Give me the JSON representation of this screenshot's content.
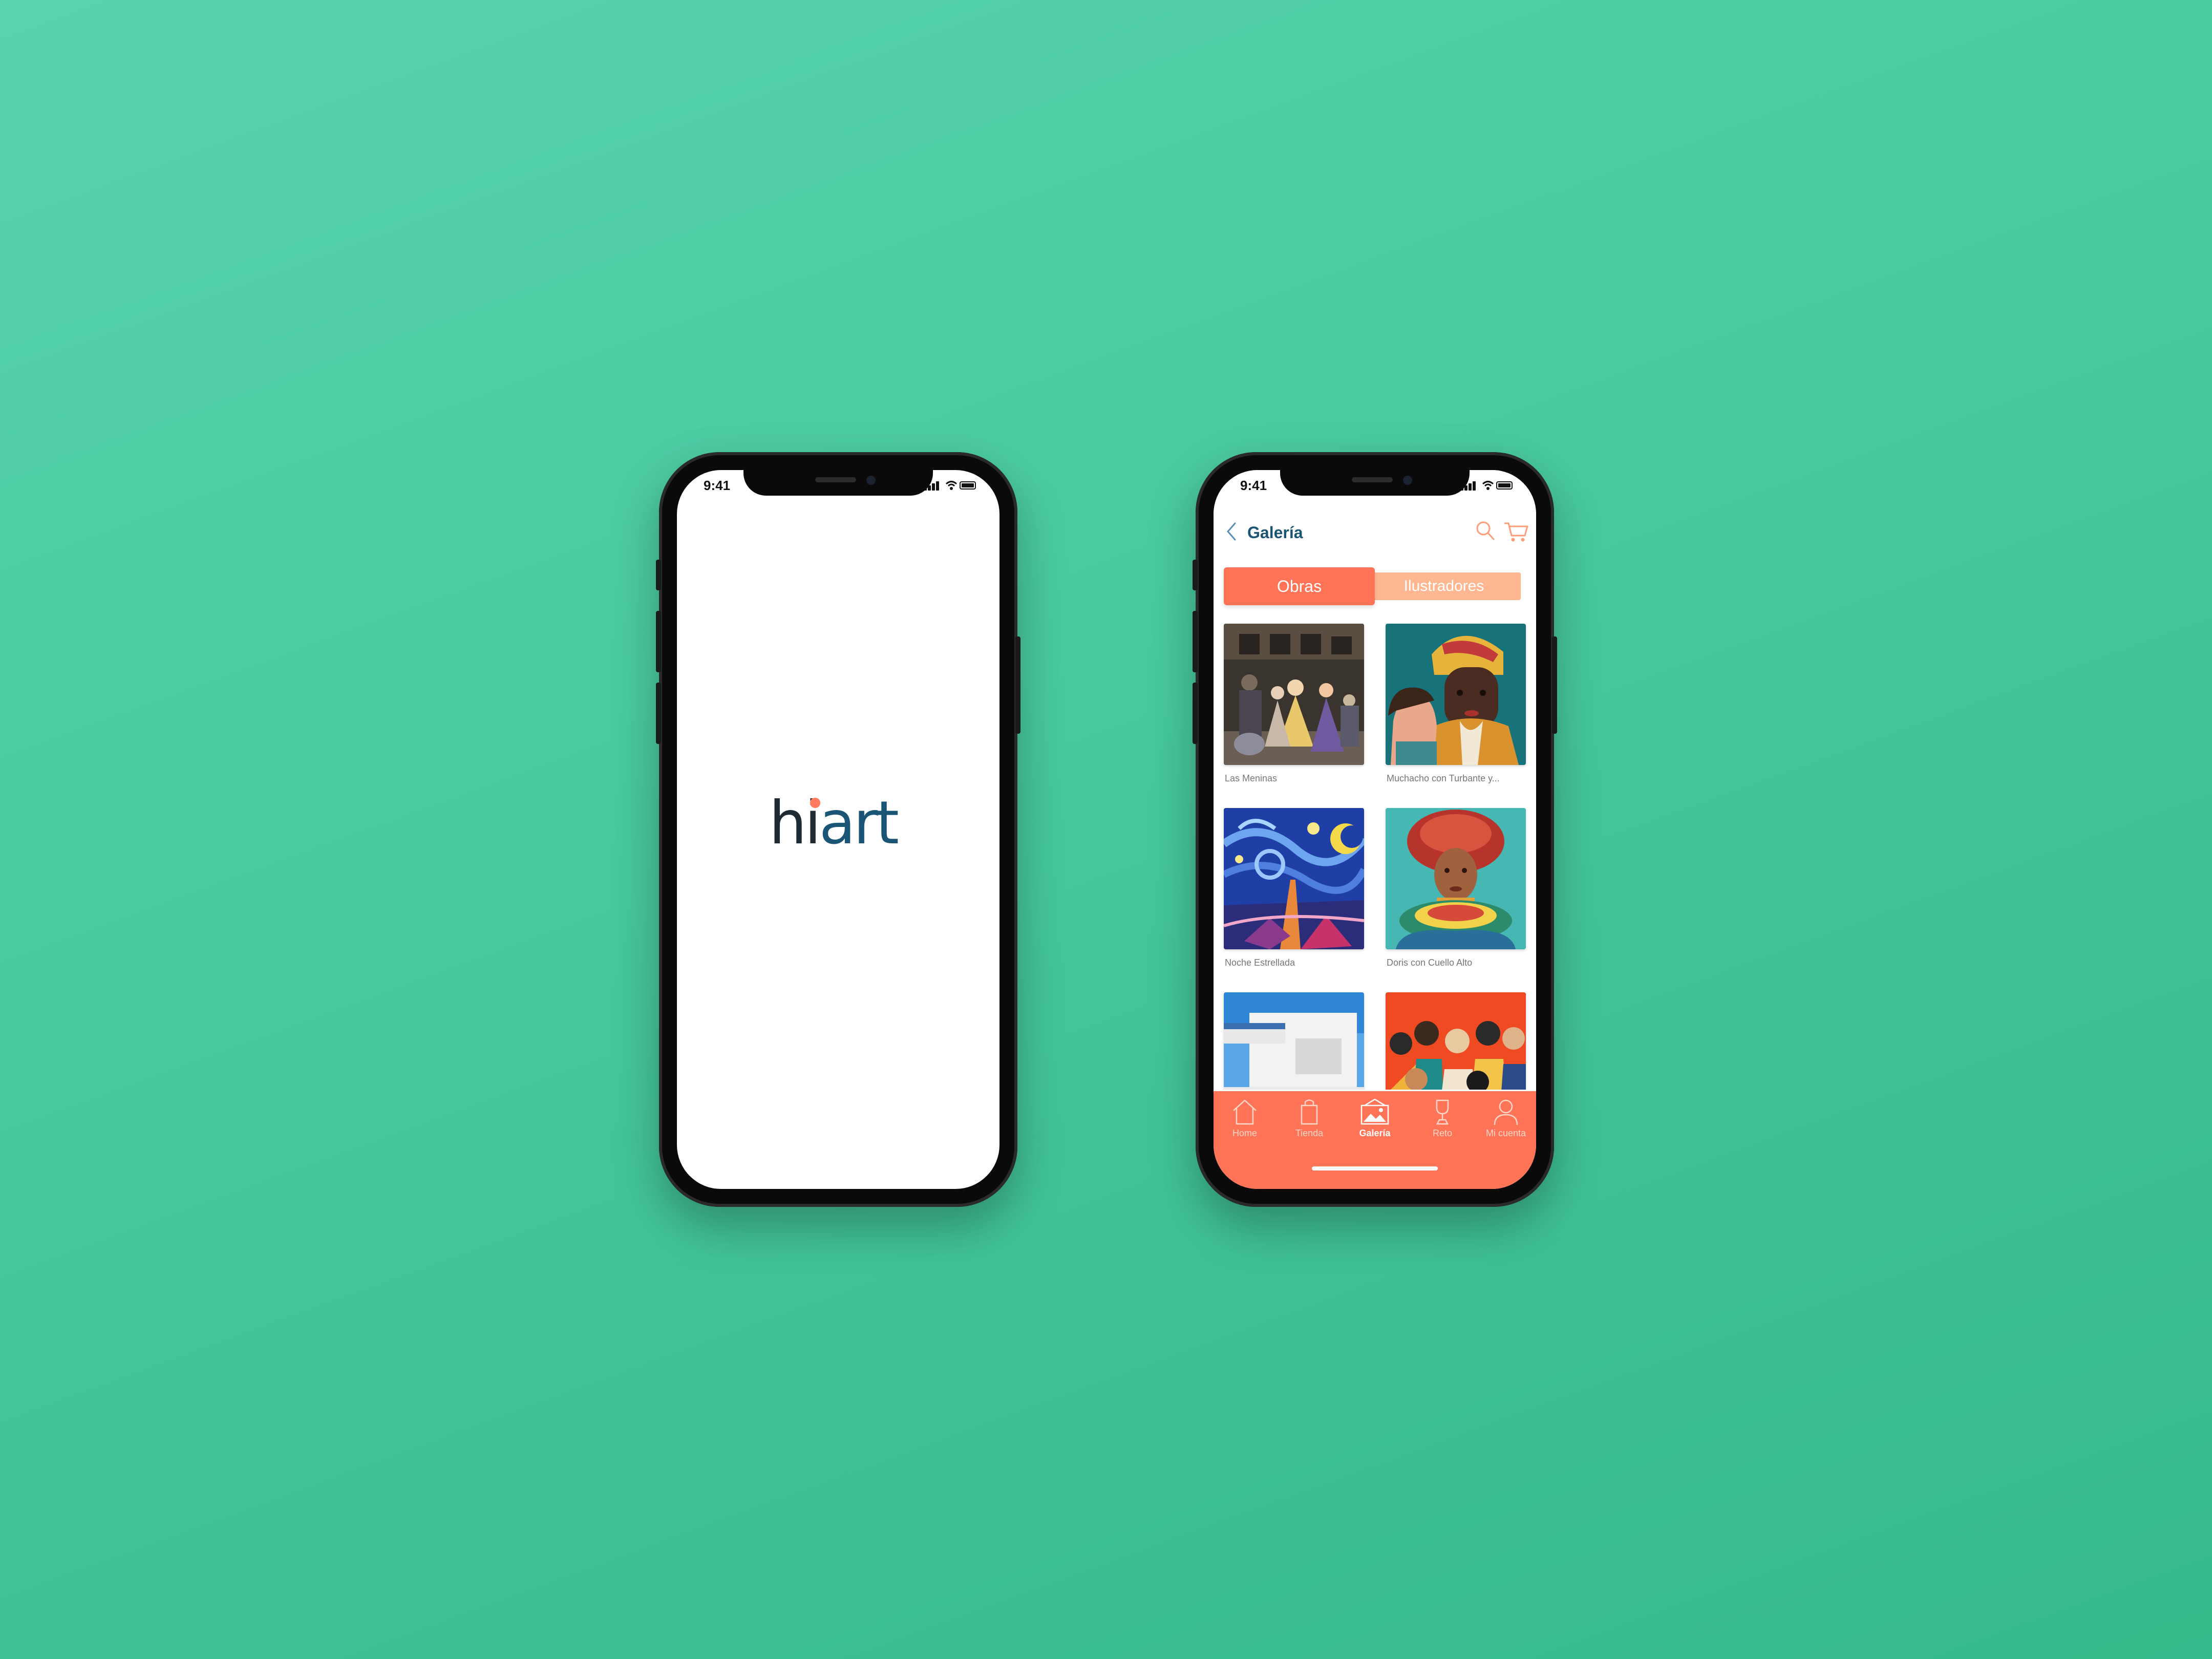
{
  "status_bar": {
    "time": "9:41"
  },
  "splash": {
    "logo_hi": "hi",
    "logo_art": "art"
  },
  "gallery": {
    "header": {
      "title": "Galería"
    },
    "segments": {
      "active": "Obras",
      "inactive": "Ilustradores"
    },
    "artworks": [
      {
        "title": "Las Meninas"
      },
      {
        "title": "Muchacho con Turbante y..."
      },
      {
        "title": "Noche Estrellada"
      },
      {
        "title": "Doris con Cuello Alto"
      },
      {
        "title": ""
      },
      {
        "title": ""
      }
    ],
    "tabbar": [
      {
        "label": "Home",
        "icon": "home-icon",
        "active": false
      },
      {
        "label": "Tienda",
        "icon": "shopping-bag-icon",
        "active": false
      },
      {
        "label": "Galería",
        "icon": "gallery-icon",
        "active": true
      },
      {
        "label": "Reto",
        "icon": "trophy-icon",
        "active": false
      },
      {
        "label": "Mi cuenta",
        "icon": "user-icon",
        "active": false
      }
    ]
  },
  "colors": {
    "background": "#4ccba2",
    "accent_coral": "#ff7457",
    "accent_peach": "#ffb792",
    "brand_blue": "#1b5576",
    "logo_dot": "#ff7b5c"
  }
}
